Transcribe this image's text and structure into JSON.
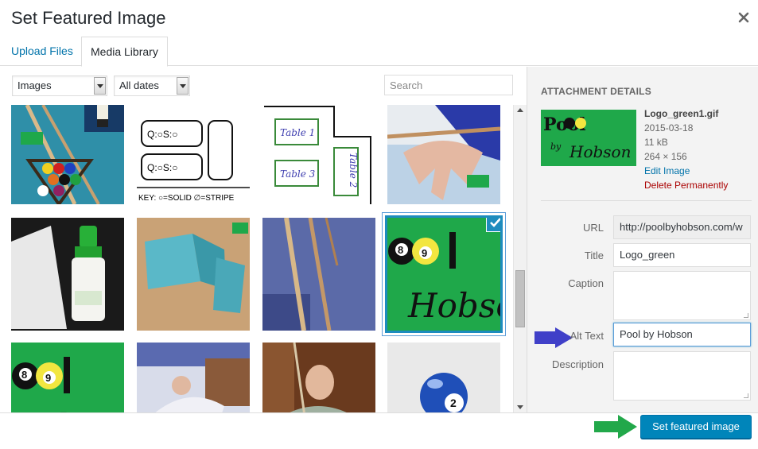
{
  "modal": {
    "title": "Set Featured Image"
  },
  "tabs": [
    {
      "label": "Upload Files"
    },
    {
      "label": "Media Library"
    }
  ],
  "filters": {
    "type_selected": "Images",
    "date_selected": "All dates",
    "search_placeholder": "Search"
  },
  "thumbnails": {
    "pool_logo_word": "Pool",
    "pool_logo_by": "by",
    "pool_logo_script": "Hobson",
    "diagram_row": "Q:○S:○",
    "diagram_key": "KEY: ○=SOLID ∅=STRIPE",
    "table_1": "Table 1",
    "table_2": "Table 2",
    "table_3": "Table 3",
    "ball_number": "2",
    "eight": "8",
    "nine": "9"
  },
  "details": {
    "heading": "ATTACHMENT DETAILS",
    "filename": "Logo_green1.gif",
    "date": "2015-03-18",
    "size": "11 kB",
    "dimensions": "264 × 156",
    "edit_link": "Edit Image",
    "delete_link": "Delete Permanently",
    "fields": {
      "url_label": "URL",
      "url_value": "http://poolbyhobson.com/w",
      "title_label": "Title",
      "title_value": "Logo_green",
      "caption_label": "Caption",
      "caption_value": "",
      "alt_label": "Alt Text",
      "alt_value": "Pool by Hobson",
      "description_label": "Description",
      "description_value": ""
    }
  },
  "footer": {
    "primary_button": "Set featured image"
  },
  "colors": {
    "accent": "#0085ba",
    "link": "#0073aa",
    "delete": "#a00000",
    "logo_green": "#1fa84a",
    "annotation_blue": "#4040c8",
    "annotation_green": "#22a84a"
  }
}
